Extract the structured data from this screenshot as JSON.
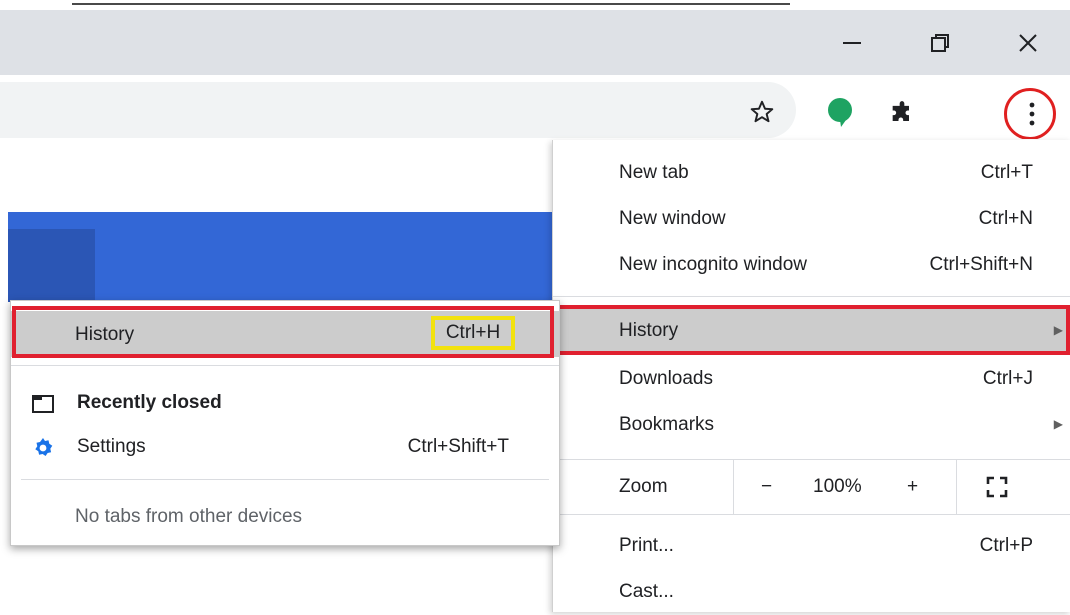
{
  "window": {
    "minimize_icon": "minimize-icon",
    "maximize_icon": "restore-icon",
    "close_icon": "close-icon"
  },
  "toolbar": {
    "bookmark_icon": "star-icon",
    "extension_icon": "puzzle-icon",
    "menu_icon": "three-dot-menu-icon",
    "highlight_color": "#e02020"
  },
  "menu": {
    "items": [
      {
        "label": "New tab",
        "shortcut": "Ctrl+T"
      },
      {
        "label": "New window",
        "shortcut": "Ctrl+N"
      },
      {
        "label": "New incognito window",
        "shortcut": "Ctrl+Shift+N"
      },
      {
        "label": "History",
        "shortcut": ""
      },
      {
        "label": "Downloads",
        "shortcut": "Ctrl+J"
      },
      {
        "label": "Bookmarks",
        "shortcut": ""
      },
      {
        "label": "Print...",
        "shortcut": "Ctrl+P"
      },
      {
        "label": "Cast...",
        "shortcut": ""
      }
    ],
    "zoom": {
      "label": "Zoom",
      "minus": "−",
      "value": "100%",
      "plus": "+",
      "fullscreen_icon": "fullscreen-icon"
    }
  },
  "history_submenu": {
    "history_label": "History",
    "history_shortcut": "Ctrl+H",
    "recently_closed": "Recently closed",
    "settings_label": "Settings",
    "settings_shortcut": "Ctrl+Shift+T",
    "no_tabs": "No tabs from other devices"
  }
}
